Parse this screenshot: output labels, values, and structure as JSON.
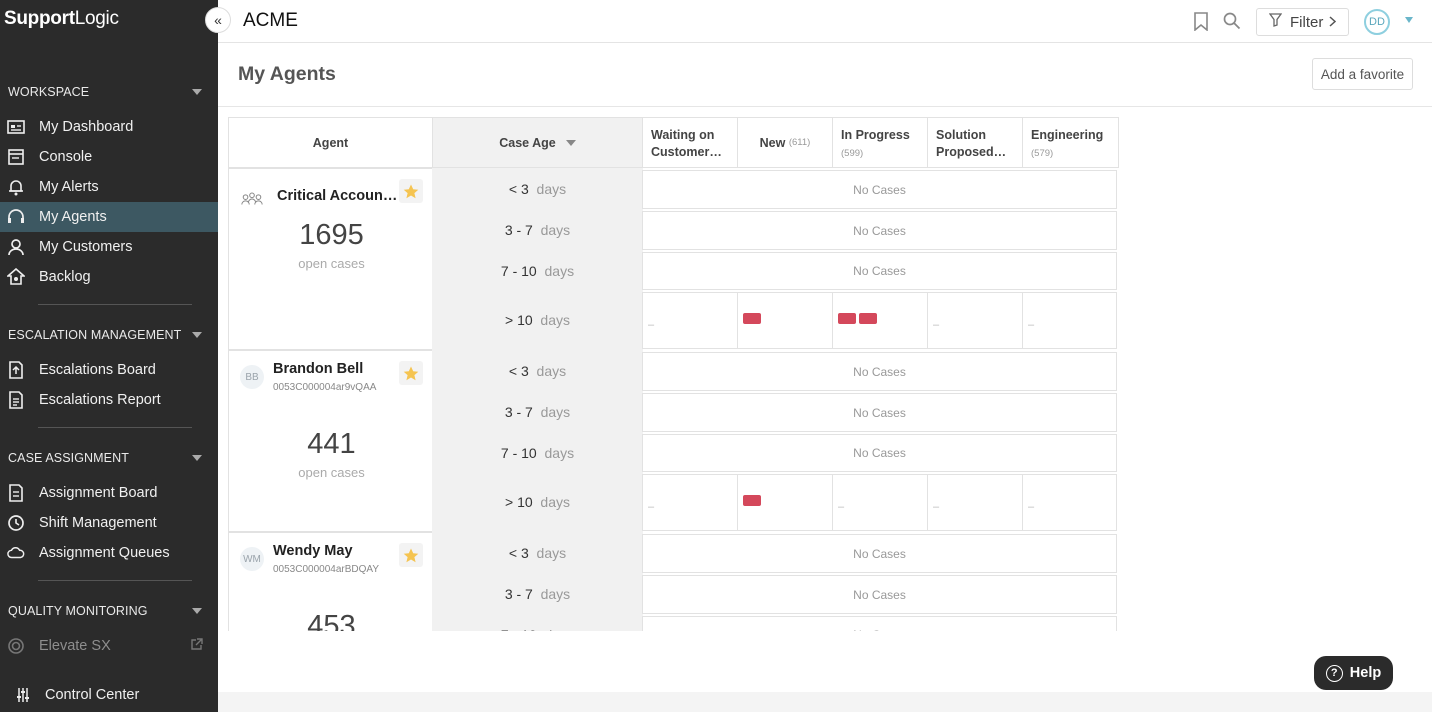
{
  "brand": {
    "bold": "Support",
    "light": "Logic"
  },
  "sidebar": {
    "sections": [
      {
        "title": "WORKSPACE",
        "items": [
          {
            "label": "My Dashboard",
            "icon": "dashboard-icon"
          },
          {
            "label": "Console",
            "icon": "console-icon"
          },
          {
            "label": "My Alerts",
            "icon": "bell-icon"
          },
          {
            "label": "My Agents",
            "icon": "headset-icon",
            "active": true
          },
          {
            "label": "My Customers",
            "icon": "person-icon"
          },
          {
            "label": "Backlog",
            "icon": "backlog-icon"
          }
        ]
      },
      {
        "title": "ESCALATION MANAGEMENT",
        "items": [
          {
            "label": "Escalations Board",
            "icon": "escalation-board-icon"
          },
          {
            "label": "Escalations Report",
            "icon": "report-icon"
          }
        ]
      },
      {
        "title": "CASE ASSIGNMENT",
        "items": [
          {
            "label": "Assignment Board",
            "icon": "assignment-board-icon"
          },
          {
            "label": "Shift Management",
            "icon": "clock-icon"
          },
          {
            "label": "Assignment Queues",
            "icon": "cloud-icon"
          }
        ]
      },
      {
        "title": "QUALITY MONITORING",
        "items": [
          {
            "label": "Elevate SX",
            "icon": "elevate-icon"
          }
        ]
      }
    ],
    "footer": {
      "label": "Control Center",
      "icon": "sliders-icon"
    }
  },
  "topbar": {
    "title": "ACME",
    "filter_label": "Filter",
    "avatar_initials": "DD"
  },
  "page": {
    "title": "My Agents",
    "add_favorite": "Add a favorite"
  },
  "grid": {
    "headers": {
      "agent": "Agent",
      "case_age": "Case Age",
      "statuses": [
        {
          "label": "Waiting on Customer…",
          "count": ""
        },
        {
          "label": "New",
          "count": "(611)"
        },
        {
          "label": "In Progress",
          "count": "(599)"
        },
        {
          "label": "Solution Proposed…",
          "count": ""
        },
        {
          "label": "Engineering",
          "count": "(579)"
        }
      ]
    },
    "age_buckets": [
      {
        "num": "< 3",
        "unit": "days"
      },
      {
        "num": "3 - 7",
        "unit": "days"
      },
      {
        "num": "7 - 10",
        "unit": "days"
      },
      {
        "num": "> 10",
        "unit": "days"
      }
    ],
    "no_cases": "No Cases",
    "dash": "–",
    "agents": [
      {
        "name": "Critical Account ...",
        "id": "",
        "initials": "",
        "count": "1695",
        "count_label": "open cases",
        "over10_chips": [
          0,
          1,
          2,
          0,
          0
        ]
      },
      {
        "name": "Brandon Bell",
        "id": "0053C000004ar9vQAA",
        "initials": "BB",
        "count": "441",
        "count_label": "open cases",
        "over10_chips": [
          0,
          1,
          0,
          0,
          0
        ]
      },
      {
        "name": "Wendy May",
        "id": "0053C000004arBDQAY",
        "initials": "WM",
        "count": "453",
        "count_label": "open cases",
        "over10_chips": [
          0,
          0,
          0,
          0,
          0
        ]
      }
    ]
  },
  "help": {
    "label": "Help"
  },
  "colors": {
    "sidebar_bg": "#2b2b2b",
    "active_bg": "#3d5862",
    "case_chip": "#d4485b",
    "star": "#f5c451"
  }
}
